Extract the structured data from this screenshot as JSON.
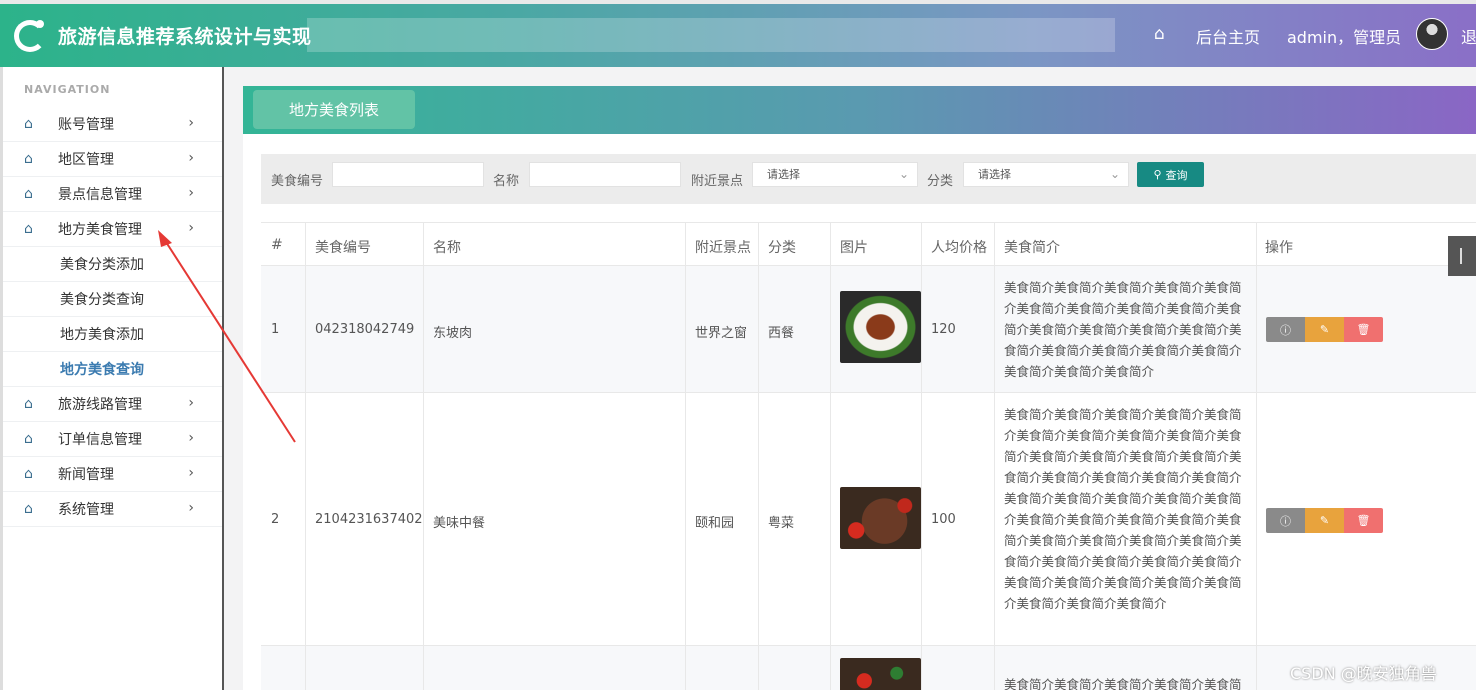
{
  "header": {
    "app_title": "旅游信息推荐系统设计与实现",
    "home_label": "后台主页",
    "user_label": "admin，管理员",
    "logout_label": "退"
  },
  "sidebar": {
    "heading": "NAVIGATION",
    "items": [
      {
        "label": "账号管理"
      },
      {
        "label": "地区管理"
      },
      {
        "label": "景点信息管理"
      },
      {
        "label": "地方美食管理"
      },
      {
        "label": "旅游线路管理"
      },
      {
        "label": "订单信息管理"
      },
      {
        "label": "新闻管理"
      },
      {
        "label": "系统管理"
      }
    ],
    "subitems": [
      {
        "label": "美食分类添加"
      },
      {
        "label": "美食分类查询"
      },
      {
        "label": "地方美食添加"
      },
      {
        "label": "地方美食查询",
        "active": true
      }
    ]
  },
  "main": {
    "tab_label": "地方美食列表",
    "search": {
      "code_label": "美食编号",
      "name_label": "名称",
      "spot_label": "附近景点",
      "spot_placeholder": "请选择",
      "category_label": "分类",
      "category_placeholder": "请选择",
      "button_label": "查询"
    },
    "table": {
      "headers": [
        "#",
        "美食编号",
        "名称",
        "附近景点",
        "分类",
        "图片",
        "人均价格",
        "美食简介",
        "操作"
      ],
      "rows": [
        {
          "index": "1",
          "code": "042318042749",
          "name": "东坡肉",
          "spot": "世界之窗",
          "category": "西餐",
          "price": "120",
          "desc": "美食简介美食简介美食简介美食简介美食简介美食简介美食简介美食简介美食简介美食简介美食简介美食简介美食简介美食简介美食简介美食简介美食简介美食简介美食简介美食简介美食简介美食简介"
        },
        {
          "index": "2",
          "code": "2104231637402",
          "name": "美味中餐",
          "spot": "颐和园",
          "category": "粤菜",
          "price": "100",
          "desc": "美食简介美食简介美食简介美食简介美食简介美食简介美食简介美食简介美食简介美食简介美食简介美食简介美食简介美食简介美食简介美食简介美食简介美食简介美食简介美食简介美食简介美食简介美食简介美食简介美食简介美食简介美食简介美食简介美食简介美食简介美食简介美食简介美食简介美食简介美食简介美食简介美食简介美食简介美食简介美食简介美食简介美食简介美食简介美食简介美食简介美食简介"
        },
        {
          "index": "",
          "code": "",
          "name": "",
          "spot": "",
          "category": "",
          "price": "",
          "desc": "美食简介美食简介美食简介美食简介美食简介美食简介"
        }
      ]
    }
  },
  "watermark": "CSDN @晚安独角兽",
  "colors": {
    "accent": "#178a83",
    "edit": "#e8a33d",
    "delete": "#f0706f",
    "info": "#8a8a8a",
    "arrow": "#e53935"
  },
  "icons": [
    "home-icon",
    "avatar",
    "search-icon",
    "info-icon",
    "edit-icon",
    "delete-icon",
    "chevron-right-icon"
  ]
}
